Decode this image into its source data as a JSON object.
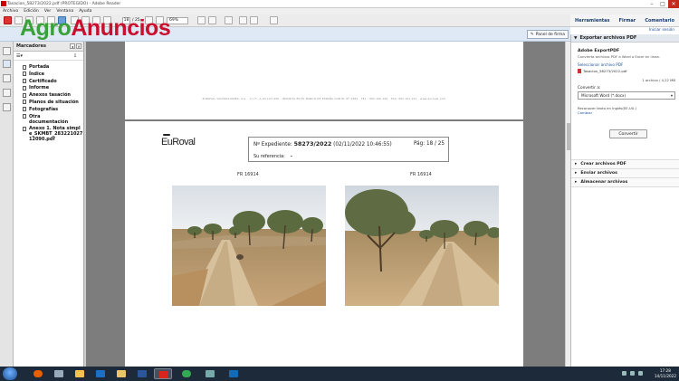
{
  "window": {
    "title": "Tasacion_58273/2022.pdf (PROTEGIDO) - Adobe Reader"
  },
  "menu": [
    "Archivo",
    "Edición",
    "Ver",
    "Ventana",
    "Ayuda"
  ],
  "toolbar": {
    "page_current": "18",
    "page_total": "/ 25",
    "zoom": "69%"
  },
  "watermark": {
    "agro": "Agro",
    "anuncios": "Anuncios"
  },
  "right_tabs": [
    "Herramientas",
    "Firmar",
    "Comentario"
  ],
  "right_link": "Iniciar sesión",
  "panel_button": "Panel de firma",
  "sidebar": {
    "title": "Marcadores",
    "items": [
      "Portada",
      "Índice",
      "Certificado",
      "Informe",
      "Anexos tasación",
      "Planos de situación",
      "Fotografías",
      "Otra documentación",
      "Anexo 1. Nota simple_SKMBT_28322102712090.pdf"
    ]
  },
  "document": {
    "footer_text": "EUROVAL VALORACIONES, S.A. · C.I.F.: A-03.123.456 · INSCRITA EN EL BANCO DE ESPAÑA CON EL Nº 4382 · TEL.: 902 100 100 · FAX: 902 101 101 · www.euroval.com",
    "brand": "EuRoval",
    "expediente_label": "Nº Expediente:",
    "expediente_value": "58273/2022",
    "expediente_date": "(02/11/2022 10:46:55)",
    "page_label": "Pág: 18 / 25",
    "ref_label": "Su referencia:",
    "ref_value": "-",
    "photo_left_caption": "FR 16914",
    "photo_right_caption": "FR 16914"
  },
  "right_panel": {
    "export_header": "Exportar archivos PDF",
    "adobe_title": "Adobe ExportPDF",
    "adobe_desc": "Convierta archivos PDF a Word o Excel en línea.",
    "select_link": "Seleccionar archivo PDF",
    "file_name": "Tasacion_58273/2022.pdf",
    "file_count": "1 archivo / 4,22 MB",
    "convert_label": "Convertir a:",
    "convert_value": "Microsoft Word (*.docx)",
    "recognize_text": "Reconocer texto en Inglés(EE.UU.)",
    "change_link": "Cambiar",
    "convert_button": "Convertir",
    "sections": [
      "Crear archivos PDF",
      "Enviar archivos",
      "Almacenar archivos"
    ]
  },
  "taskbar": {
    "time": "17:28",
    "date": "14/11/2022"
  },
  "colors": {
    "agro_green": "#3aa13a",
    "anuncios_red": "#c8102e",
    "doc_bg": "#7d7d7d",
    "taskbar": "#1c2a3a"
  }
}
